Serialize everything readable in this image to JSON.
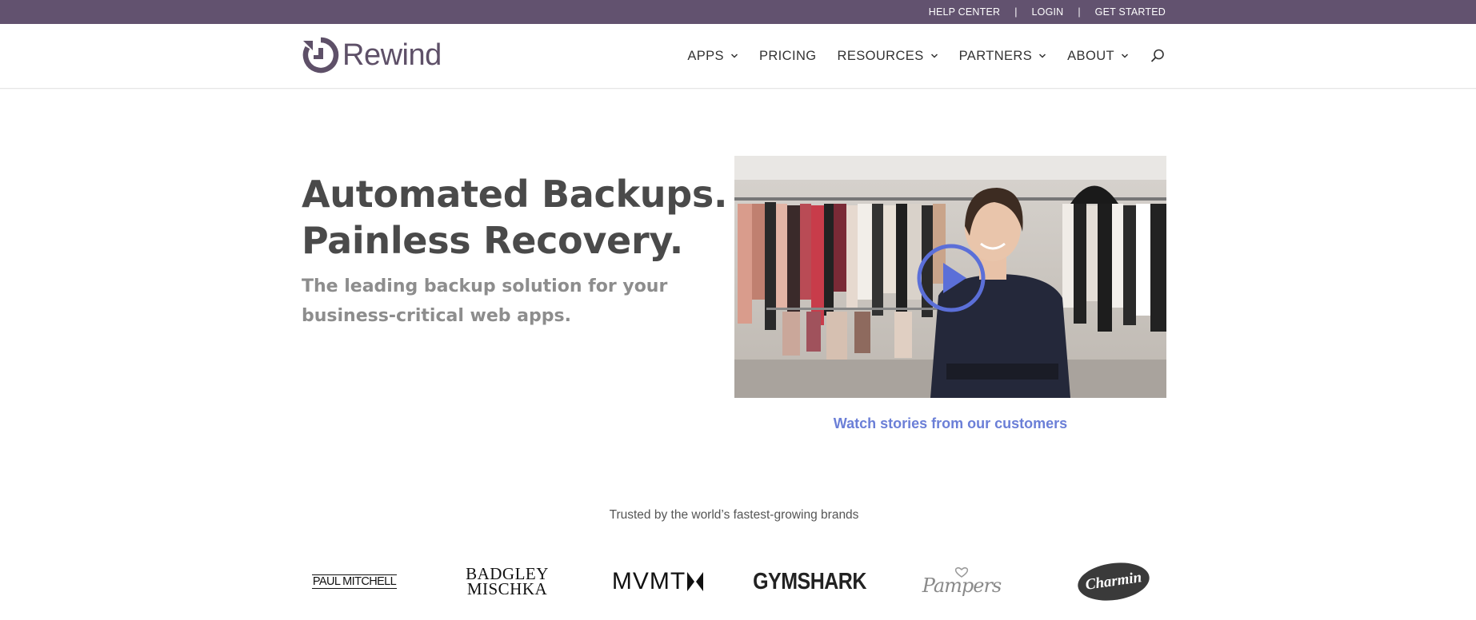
{
  "topbar": {
    "links": [
      "HELP CENTER",
      "LOGIN",
      "GET STARTED"
    ],
    "separator": "|"
  },
  "header": {
    "logo_text": "Rewind",
    "nav": [
      {
        "label": "APPS",
        "dropdown": true
      },
      {
        "label": "PRICING",
        "dropdown": false
      },
      {
        "label": "RESOURCES",
        "dropdown": true
      },
      {
        "label": "PARTNERS",
        "dropdown": true
      },
      {
        "label": "ABOUT",
        "dropdown": true
      }
    ],
    "search_icon": "search-icon"
  },
  "hero": {
    "title_line1": "Automated Backups.",
    "title_line2": "Painless Recovery.",
    "subtitle_line1": "The leading backup solution for your",
    "subtitle_line2": "business-critical web apps."
  },
  "video": {
    "play_icon": "play-icon",
    "link_text": "Watch stories from our customers"
  },
  "brands": {
    "heading": "Trusted by the world’s fastest-growing brands",
    "logos": [
      "PAUL MITCHELL",
      "BADGLEY",
      "MISCHKA",
      "MVMT",
      "GYMSHARK",
      "Pampers",
      "Charmin"
    ]
  },
  "colors": {
    "topbar_bg": "#62526f",
    "brand_purple": "#5e5068",
    "link_blue": "#6b7fd7",
    "play_blue": "#5b6fd8"
  }
}
